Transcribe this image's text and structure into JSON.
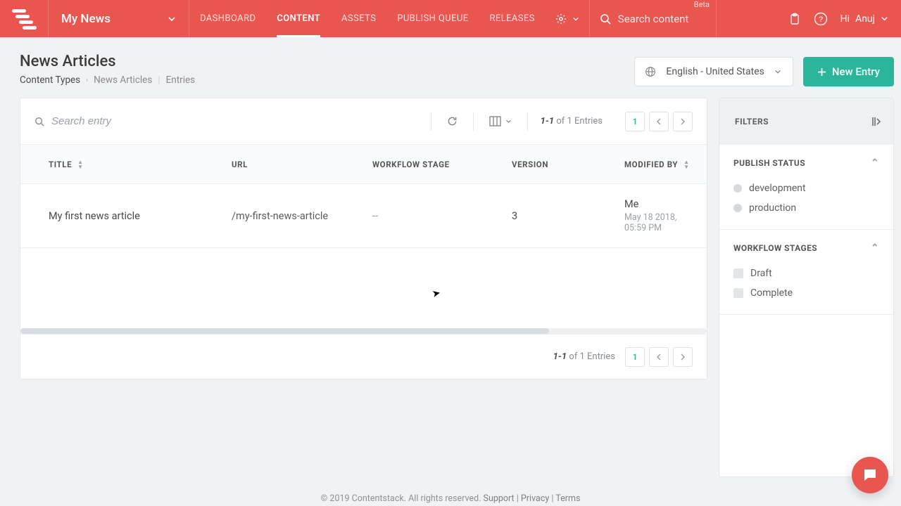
{
  "header": {
    "beta": "Beta",
    "stack": "My News",
    "nav": {
      "dashboard": "DASHBOARD",
      "content": "CONTENT",
      "assets": "ASSETS",
      "publish_queue": "PUBLISH QUEUE",
      "releases": "RELEASES"
    },
    "search_placeholder": "Search content",
    "greeting_prefix": "Hi",
    "user_name": "Anuj"
  },
  "page": {
    "title": "News Articles",
    "breadcrumb": {
      "root": "Content Types",
      "mid": "News Articles",
      "leaf": "Entries"
    },
    "language": "English - United States",
    "new_entry": "New Entry"
  },
  "toolbar": {
    "search_placeholder": "Search entry",
    "range": "1-1",
    "of_text": "of 1 Entries",
    "page": "1"
  },
  "columns": {
    "title": "TITLE",
    "url": "URL",
    "stage": "WORKFLOW STAGE",
    "version": "VERSION",
    "modified_by": "MODIFIED BY"
  },
  "rows": [
    {
      "title": "My first news article",
      "url": "/my-first-news-article",
      "stage": "--",
      "version": "3",
      "modified_by": "Me",
      "modified_at": "May 18 2018, 05:59 PM"
    }
  ],
  "filters": {
    "head": "FILTERS",
    "publish_status": {
      "label": "PUBLISH STATUS",
      "dev": "development",
      "prod": "production"
    },
    "workflow": {
      "label": "WORKFLOW STAGES",
      "draft": "Draft",
      "complete": "Complete"
    }
  },
  "footer": {
    "copyright": "© 2019 Contentstack. All rights reserved.",
    "support": "Support",
    "privacy": "Privacy",
    "terms": "Terms"
  }
}
